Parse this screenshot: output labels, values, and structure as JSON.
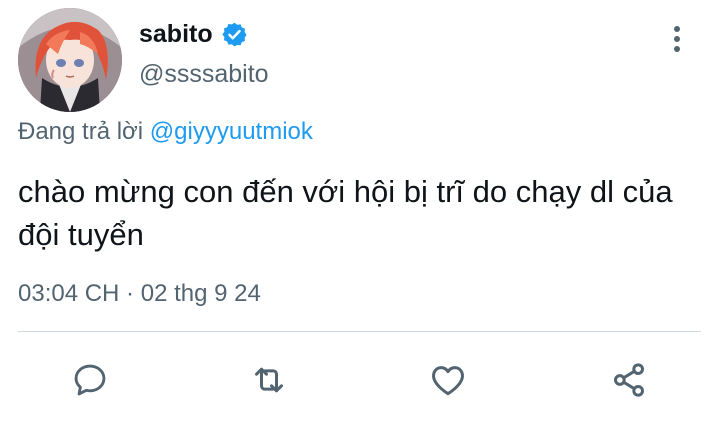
{
  "author": {
    "display_name": "sabito",
    "handle": "@ssssabito",
    "verified": true
  },
  "reply_context": {
    "prefix": "Đang trả lời",
    "mention": "@giyyyuutmiok"
  },
  "tweet": {
    "text": "chào mừng con đến với hội bị trĩ do chạy dl của đội tuyển",
    "timestamp": "03:04 CH · 02 thg 9 24"
  },
  "icons": {
    "more": "more-vertical-icon",
    "reply": "reply-icon",
    "retweet": "retweet-icon",
    "like": "heart-icon",
    "share": "share-icon",
    "verified": "verified-badge-icon"
  },
  "colors": {
    "accent": "#1d9bf0",
    "text_primary": "#0f1419",
    "text_secondary": "#536471",
    "icon": "#536471",
    "divider": "#cfd9de"
  }
}
